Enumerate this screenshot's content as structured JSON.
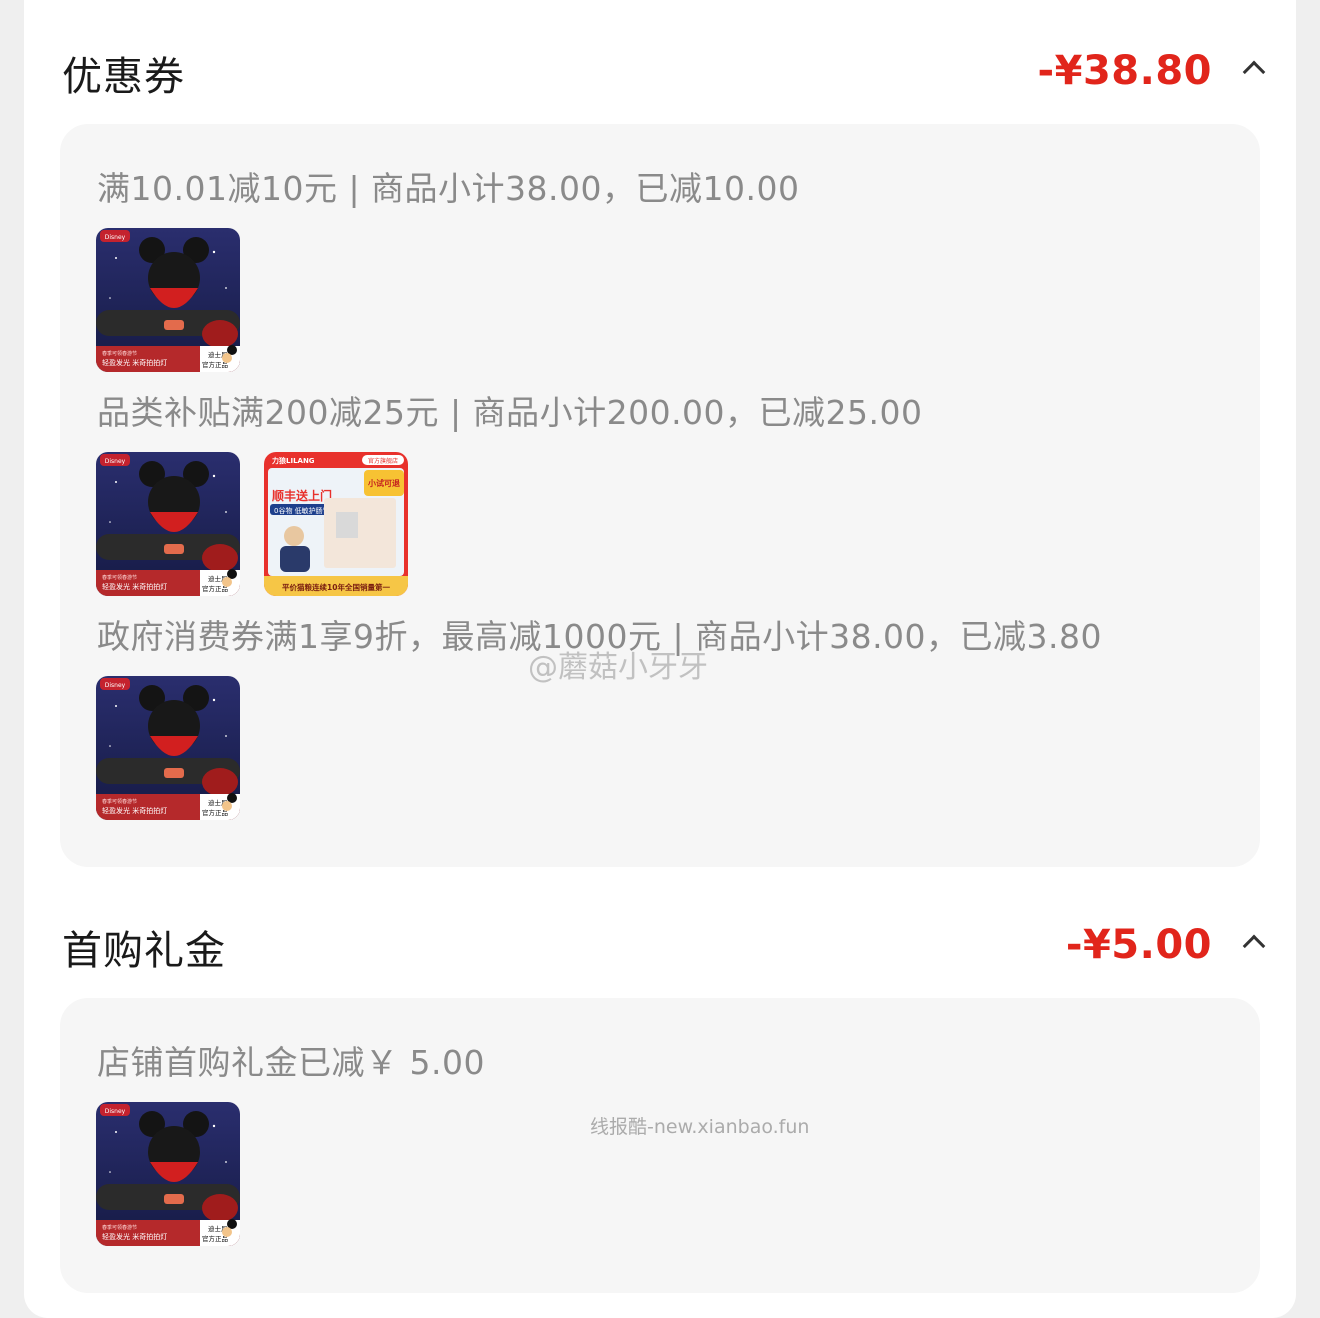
{
  "coupon": {
    "title": "优惠券",
    "amount": "-¥38.80",
    "rules": [
      {
        "text": "满10.01减10元 | 商品小计38.00，已减10.00"
      },
      {
        "text": "品类补贴满200减25元 | 商品小计200.00，已减25.00"
      },
      {
        "text": "政府消费券满1享9折，最高减1000元 | 商品小计38.00，已减3.80"
      }
    ]
  },
  "first_purchase": {
    "title": "首购礼金",
    "amount": "-¥5.00",
    "rules": [
      {
        "text": "店铺首购礼金已减￥ 5.00"
      }
    ]
  },
  "product_mickey": {
    "brand": "Disney",
    "tagline_top": "春季可领春游节",
    "tagline": "轻盈发光 米奇拍拍灯",
    "badge_line1": "迪士尼",
    "badge_line2": "官方正品"
  },
  "product_catfood": {
    "brand": "力狼LILANG",
    "store": "官方旗舰店",
    "headline": "顺丰送上门",
    "sub": "0谷物 低敏护肠胃",
    "corner": "小试可退",
    "banner": "平价猫粮连续10年全国销量第一"
  },
  "watermarks": {
    "weibo": "@蘑菇小牙牙",
    "site": "线报酷-new.xianbao.fun"
  },
  "colors": {
    "price_red": "#e1251b",
    "panel_bg": "#f6f6f6",
    "rule_text": "#8a8a8a"
  }
}
